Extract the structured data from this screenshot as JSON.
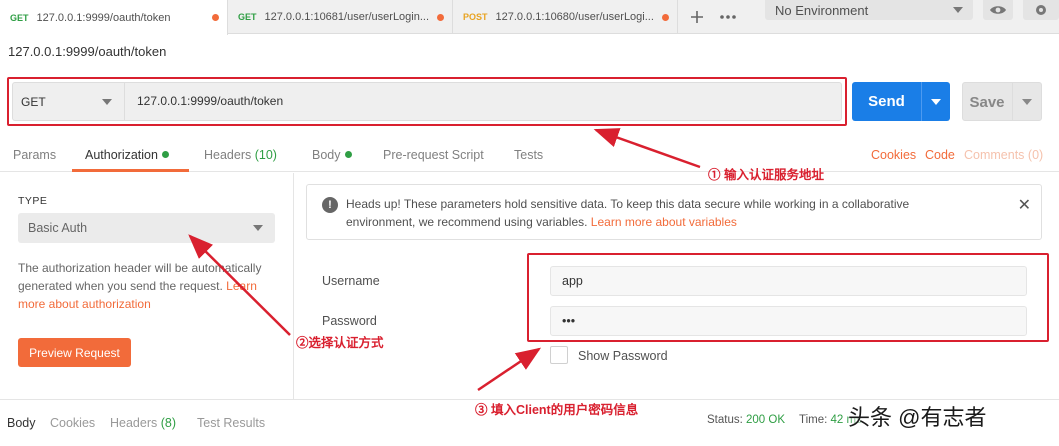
{
  "tabs": [
    {
      "method": "GET",
      "url": "127.0.0.1:9999/oauth/token"
    },
    {
      "method": "GET",
      "url": "127.0.0.1:10681/user/userLogin..."
    },
    {
      "method": "POST",
      "url": "127.0.0.1:10680/user/userLogi..."
    }
  ],
  "environment": "No Environment",
  "request_title": "127.0.0.1:9999/oauth/token",
  "request": {
    "method": "GET",
    "url": "127.0.0.1:9999/oauth/token"
  },
  "buttons": {
    "send": "Send",
    "save": "Save"
  },
  "request_tabs": {
    "params": "Params",
    "authorization": "Authorization",
    "headers": "Headers",
    "headers_count": "(10)",
    "body": "Body",
    "prerequest": "Pre-request Script",
    "tests": "Tests"
  },
  "right_links": {
    "cookies": "Cookies",
    "code": "Code",
    "comments": "Comments (0)"
  },
  "auth": {
    "type_label": "TYPE",
    "type_value": "Basic Auth",
    "description": "The authorization header will be automatically generated when you send the request.",
    "learn_more": "Learn more about authorization",
    "preview_button": "Preview Request"
  },
  "info": {
    "text": "Heads up! These parameters hold sensitive data. To keep this data secure while working in a collaborative environment, we recommend using variables.",
    "link": "Learn more about variables"
  },
  "fields": {
    "username_label": "Username",
    "username_value": "app",
    "password_label": "Password",
    "password_value": "•••",
    "show_password": "Show Password"
  },
  "response": {
    "body": "Body",
    "cookies": "Cookies",
    "headers": "Headers",
    "headers_count": "(8)",
    "test_results": "Test Results",
    "status_label": "Status:",
    "status_value": "200 OK",
    "time_label": "Time:",
    "time_value": "42 ms"
  },
  "annotations": {
    "a1": "① 输入认证服务地址",
    "a2": "②选择认证方式",
    "a3": "③ 填入Client的用户密码信息"
  },
  "watermark": "头条 @有志者",
  "colors": {
    "accent": "#f26b3a",
    "send": "#1a7ee7",
    "get": "#2f9e44",
    "post": "#e8a321",
    "annotation": "#d9202f"
  }
}
